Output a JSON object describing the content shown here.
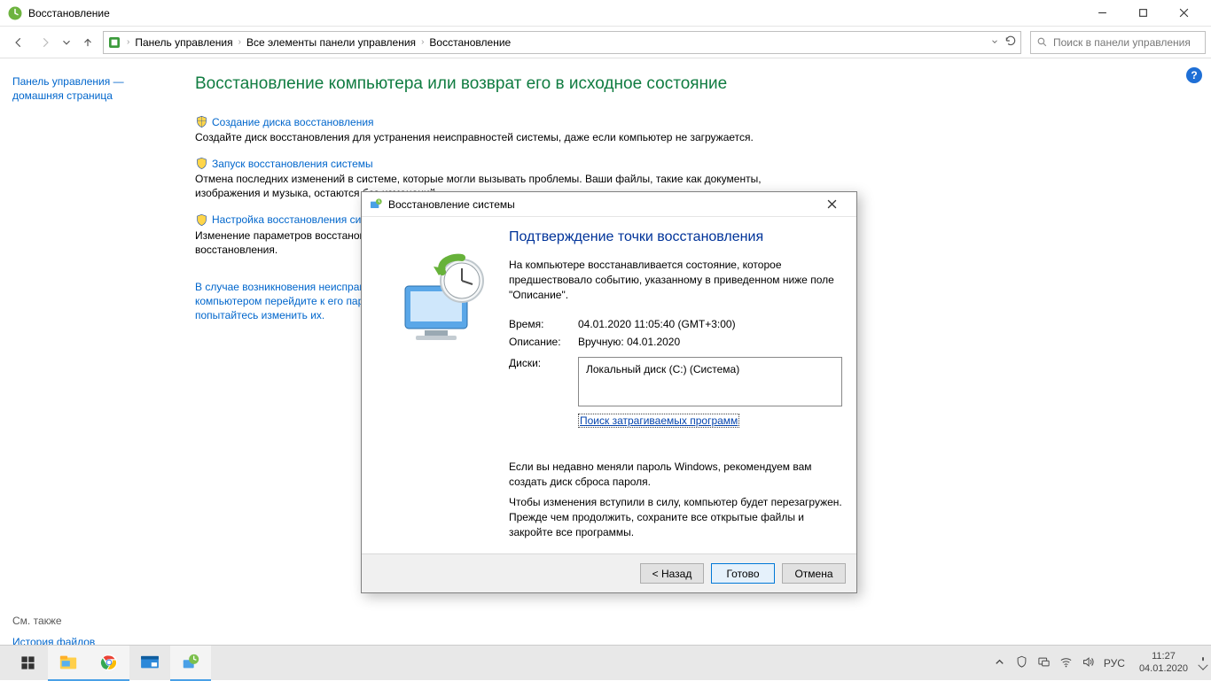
{
  "window": {
    "title": "Восстановление"
  },
  "nav": {
    "crumbs": [
      "Панель управления",
      "Все элементы панели управления",
      "Восстановление"
    ],
    "search_placeholder": "Поиск в панели управления"
  },
  "sidebar": {
    "home_link": "Панель управления — домашняя страница",
    "see_also_label": "См. также",
    "see_also_link": "История файлов"
  },
  "main": {
    "heading": "Восстановление компьютера или возврат его в исходное состояние",
    "options": [
      {
        "title": "Создание диска восстановления",
        "desc": "Создайте диск восстановления для устранения неисправностей системы, даже если компьютер не загружается."
      },
      {
        "title": "Запуск восстановления системы",
        "desc": "Отмена последних изменений в системе, которые могли вызывать проблемы. Ваши файлы, такие как документы, изображения и музыка, остаются без изменений."
      },
      {
        "title": "Настройка восстановления системы",
        "desc": "Изменение параметров восстановления, управление дисковым пространством, а также создание и удаление точек восстановления."
      }
    ],
    "extra_link": "В случае возникновения неисправностей с компьютером перейдите к его параметрам и попытайтесь изменить их."
  },
  "dialog": {
    "title": "Восстановление системы",
    "heading": "Подтверждение точки восстановления",
    "intro": "На компьютере восстанавливается состояние, которое предшествовало событию, указанному в приведенном ниже поле \"Описание\".",
    "time_label": "Время:",
    "time_value": "04.01.2020 11:05:40 (GMT+3:00)",
    "desc_label": "Описание:",
    "desc_value": "Вручную: 04.01.2020",
    "disks_label": "Диски:",
    "disks_value": "Локальный диск (C:) (Система)",
    "scan_link": "Поиск затрагиваемых программ",
    "note1": "Если вы недавно меняли пароль Windows, рекомендуем вам создать диск сброса пароля.",
    "note2": "Чтобы изменения вступили в силу, компьютер будет перезагружен. Прежде чем продолжить, сохраните все открытые файлы и закройте все программы.",
    "btn_back": "< Назад",
    "btn_finish": "Готово",
    "btn_cancel": "Отмена"
  },
  "taskbar": {
    "lang": "РУС",
    "time": "11:27",
    "date": "04.01.2020"
  }
}
